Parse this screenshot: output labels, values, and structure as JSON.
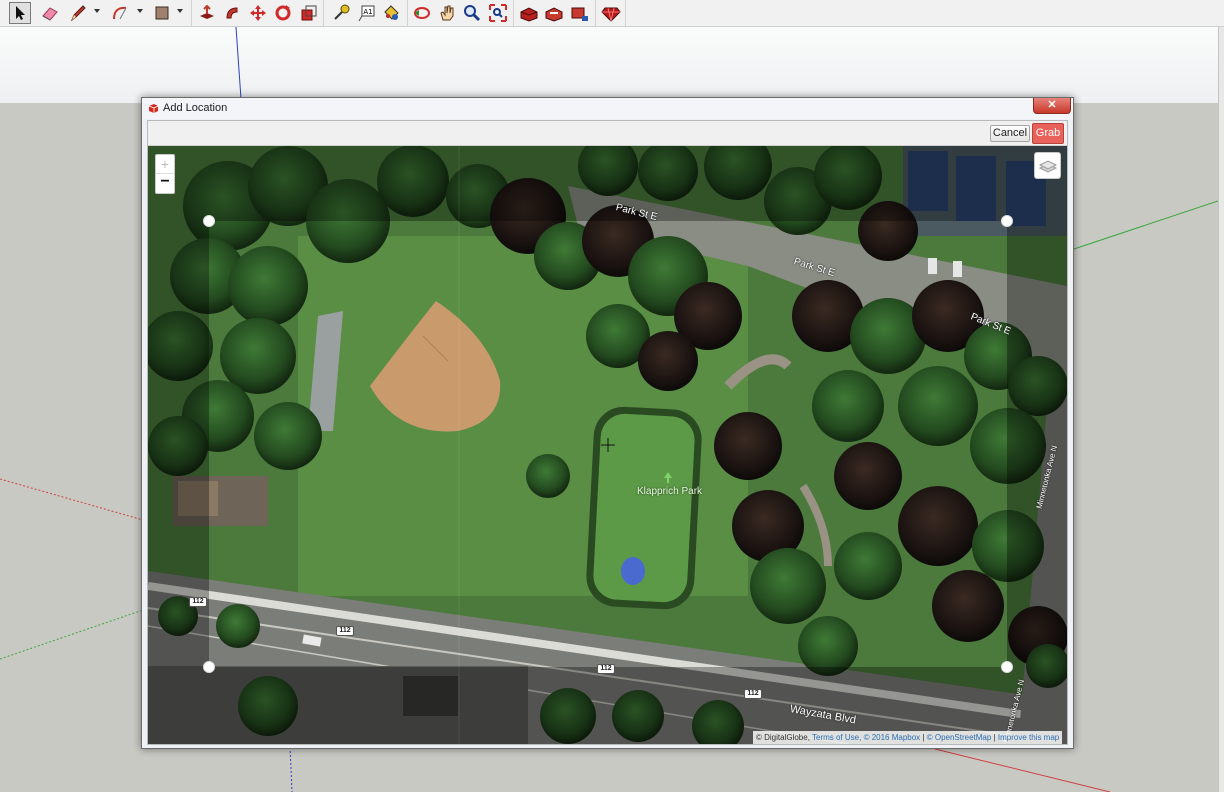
{
  "toolbar": {
    "tools": [
      {
        "name": "select-tool",
        "icon": "arrow-cursor-icon"
      },
      {
        "name": "eraser-tool",
        "icon": "eraser-icon"
      },
      {
        "name": "line-tool",
        "icon": "pencil-icon"
      },
      {
        "name": "arc-tool",
        "icon": "arc-icon"
      },
      {
        "name": "rectangle-tool",
        "icon": "rectangle-icon"
      },
      {
        "name": "push-pull-tool",
        "icon": "push-pull-icon"
      },
      {
        "name": "follow-me-tool",
        "icon": "follow-me-icon"
      },
      {
        "name": "move-tool",
        "icon": "move-icon"
      },
      {
        "name": "rotate-tool",
        "icon": "rotate-icon"
      },
      {
        "name": "scale-tool",
        "icon": "scale-icon"
      },
      {
        "name": "tape-measure-tool",
        "icon": "tape-measure-icon"
      },
      {
        "name": "text-tool",
        "icon": "text-icon"
      },
      {
        "name": "paint-bucket-tool",
        "icon": "paint-bucket-icon"
      },
      {
        "name": "orbit-tool",
        "icon": "orbit-icon"
      },
      {
        "name": "pan-tool",
        "icon": "hand-icon"
      },
      {
        "name": "zoom-tool",
        "icon": "magnifier-icon"
      },
      {
        "name": "zoom-extents-tool",
        "icon": "zoom-extents-icon"
      },
      {
        "name": "warehouse-tool",
        "icon": "warehouse-icon"
      },
      {
        "name": "share-model-tool",
        "icon": "share-model-icon"
      },
      {
        "name": "components-tool",
        "icon": "components-icon"
      },
      {
        "name": "extension-warehouse-tool",
        "icon": "ruby-icon"
      }
    ],
    "text_tool_glyph": "A1"
  },
  "dialog": {
    "title": "Add Location",
    "close_glyph": "✕",
    "cancel_label": "Cancel",
    "grab_label": "Grab"
  },
  "map": {
    "zoom_in": "+",
    "zoom_out": "−",
    "labels": {
      "park_st_1": "Park St E",
      "park_st_2": "Park St E",
      "park_st_3": "Park St E",
      "park": "Klapprich Park",
      "wayzata": "Wayzata Blvd",
      "minnetonka_1": "Minnetonka Ave N",
      "minnetonka_2": "Minnetonka Ave N"
    },
    "shields": [
      "112",
      "112",
      "112",
      "112"
    ],
    "attribution": {
      "prefix": "© DigitalGlobe,",
      "terms": "Terms of Use,",
      "mapbox": "© 2016 Mapbox",
      "sep1": "|",
      "osm": "© OpenStreetMap",
      "sep2": "|",
      "improve": "Improve this map"
    }
  },
  "colors": {
    "grab_button": "#e9615b",
    "close_button": "#c7382b",
    "axis_red": "#d04040",
    "axis_green": "#3aa83a",
    "axis_blue": "#3040c0"
  }
}
